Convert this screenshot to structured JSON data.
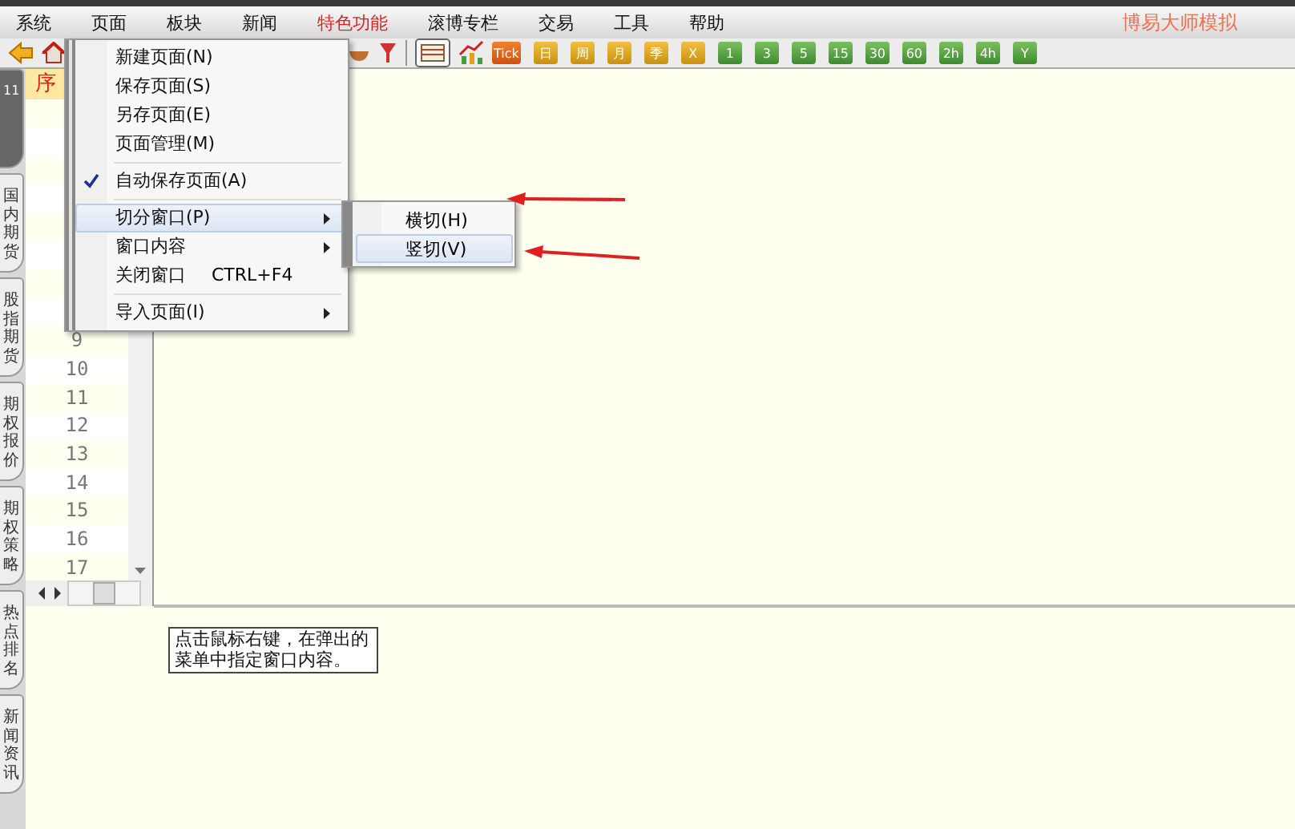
{
  "menu_bar": {
    "items": [
      {
        "label": "系统",
        "highlighted": false
      },
      {
        "label": "页面",
        "highlighted": false
      },
      {
        "label": "板块",
        "highlighted": false
      },
      {
        "label": "新闻",
        "highlighted": false
      },
      {
        "label": "特色功能",
        "highlighted": true
      },
      {
        "label": "滚博专栏",
        "highlighted": false
      },
      {
        "label": "交易",
        "highlighted": false
      },
      {
        "label": "工具",
        "highlighted": false
      },
      {
        "label": "帮助",
        "highlighted": false
      }
    ],
    "app_title": "博易大师模拟"
  },
  "toolbar": {
    "period_buttons": [
      {
        "label": "Tick",
        "kind": "tick"
      },
      {
        "label": "日",
        "kind": "day"
      },
      {
        "label": "周",
        "kind": "day"
      },
      {
        "label": "月",
        "kind": "day"
      },
      {
        "label": "季",
        "kind": "day"
      },
      {
        "label": "X",
        "kind": "day"
      },
      {
        "label": "1",
        "kind": "minute"
      },
      {
        "label": "3",
        "kind": "minute"
      },
      {
        "label": "5",
        "kind": "minute"
      },
      {
        "label": "15",
        "kind": "minute"
      },
      {
        "label": "30",
        "kind": "minute"
      },
      {
        "label": "60",
        "kind": "minute"
      },
      {
        "label": "2h",
        "kind": "minute"
      },
      {
        "label": "4h",
        "kind": "minute"
      },
      {
        "label": "Y",
        "kind": "minute"
      }
    ]
  },
  "side_tabs": [
    {
      "label": "11",
      "selected": true
    },
    {
      "label": "国内期货",
      "selected": false
    },
    {
      "label": "股指期货",
      "selected": false
    },
    {
      "label": "期权报价",
      "selected": false
    },
    {
      "label": "期权策略",
      "selected": false
    },
    {
      "label": "热点排名",
      "selected": false
    },
    {
      "label": "新闻资讯",
      "selected": false
    }
  ],
  "grid": {
    "header": "序",
    "rows": [
      "9",
      "10",
      "11",
      "12",
      "13",
      "14",
      "15",
      "16",
      "17"
    ]
  },
  "context_menu": {
    "items": [
      {
        "kind": "item",
        "label": "新建页面(N)",
        "checked": false,
        "submenu": false,
        "highlighted": false
      },
      {
        "kind": "item",
        "label": "保存页面(S)",
        "checked": false,
        "submenu": false,
        "highlighted": false
      },
      {
        "kind": "item",
        "label": "另存页面(E)",
        "checked": false,
        "submenu": false,
        "highlighted": false
      },
      {
        "kind": "item",
        "label": "页面管理(M)",
        "checked": false,
        "submenu": false,
        "highlighted": false
      },
      {
        "kind": "separator"
      },
      {
        "kind": "item",
        "label": "自动保存页面(A)",
        "checked": true,
        "submenu": false,
        "highlighted": false
      },
      {
        "kind": "separator"
      },
      {
        "kind": "item",
        "label": "切分窗口(P)",
        "checked": false,
        "submenu": true,
        "highlighted": true
      },
      {
        "kind": "item",
        "label": "窗口内容",
        "checked": false,
        "submenu": true,
        "highlighted": false
      },
      {
        "kind": "item",
        "label": "关闭窗口",
        "shortcut": "CTRL+F4",
        "checked": false,
        "submenu": false,
        "highlighted": false
      },
      {
        "kind": "separator"
      },
      {
        "kind": "item",
        "label": "导入页面(I)",
        "checked": false,
        "submenu": true,
        "highlighted": false
      }
    ]
  },
  "submenu": {
    "items": [
      {
        "label": "横切(H)",
        "highlighted": false
      },
      {
        "label": "竖切(V)",
        "highlighted": true
      }
    ]
  },
  "hint": "点击鼠标右键，在弹出的菜单中指定窗口内容。"
}
